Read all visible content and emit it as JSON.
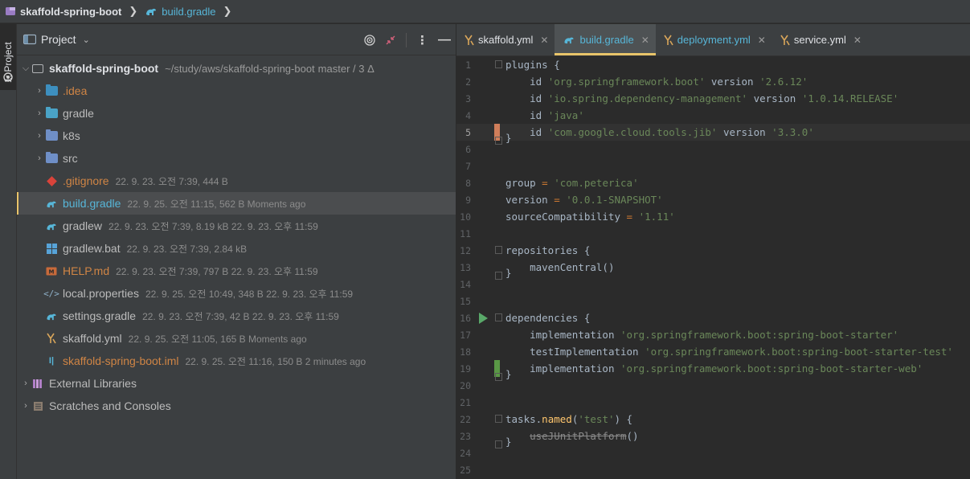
{
  "navbar": {
    "project": "skaffold-spring-boot",
    "file": "build.gradle"
  },
  "stripe": {
    "label": "1: Project"
  },
  "panel": {
    "title": "Project",
    "root": {
      "name": "skaffold-spring-boot",
      "path": "~/study/aws/skaffold-spring-boot",
      "branch": "master / 3 Δ"
    },
    "items": [
      {
        "name": ".idea",
        "meta": ""
      },
      {
        "name": "gradle",
        "meta": ""
      },
      {
        "name": "k8s",
        "meta": ""
      },
      {
        "name": "src",
        "meta": ""
      },
      {
        "name": ".gitignore",
        "meta": "22. 9. 23. 오전 7:39, 444 B"
      },
      {
        "name": "build.gradle",
        "meta": "22. 9. 25. 오전 11:15, 562 B Moments ago"
      },
      {
        "name": "gradlew",
        "meta": "22. 9. 23. 오전 7:39, 8.19 kB 22. 9. 23. 오후 11:59"
      },
      {
        "name": "gradlew.bat",
        "meta": "22. 9. 23. 오전 7:39, 2.84 kB"
      },
      {
        "name": "HELP.md",
        "meta": "22. 9. 23. 오전 7:39, 797 B 22. 9. 23. 오후 11:59"
      },
      {
        "name": "local.properties",
        "meta": "22. 9. 25. 오전 10:49, 348 B 22. 9. 23. 오후 11:59"
      },
      {
        "name": "settings.gradle",
        "meta": "22. 9. 23. 오전 7:39, 42 B 22. 9. 23. 오후 11:59"
      },
      {
        "name": "skaffold.yml",
        "meta": "22. 9. 25. 오전 11:05, 165 B Moments ago"
      },
      {
        "name": "skaffold-spring-boot.iml",
        "meta": "22. 9. 25. 오전 11:16, 150 B 2 minutes ago"
      }
    ],
    "external": "External Libraries",
    "scratches": "Scratches and Consoles"
  },
  "tabs": [
    {
      "label": "skaffold.yml"
    },
    {
      "label": "build.gradle"
    },
    {
      "label": "deployment.yml"
    },
    {
      "label": "service.yml"
    }
  ],
  "code": {
    "line_numbers": [
      "1",
      "2",
      "3",
      "4",
      "5",
      "6",
      "7",
      "8",
      "9",
      "10",
      "11",
      "12",
      "13",
      "14",
      "15",
      "16",
      "17",
      "18",
      "19",
      "20",
      "21",
      "22",
      "23",
      "24",
      "25"
    ],
    "l1": "plugins",
    "l2_id": "id",
    "l2_str": "'org.springframework.boot'",
    "l2_v": "version",
    "l2_ver": "'2.6.12'",
    "l3_str": "'io.spring.dependency-management'",
    "l3_ver": "'1.0.14.RELEASE'",
    "l4_str": "'java'",
    "l5_str": "'com.google.cloud.tools.jib'",
    "l5_ver": "'3.3.0'",
    "l8_k": "group",
    "l8_v": "'com.peterica'",
    "l9_k": "version",
    "l9_v": "'0.0.1-SNAPSHOT'",
    "l10_k": "sourceCompatibility",
    "l10_v": "'1.11'",
    "l12": "repositories",
    "l13": "mavenCentral",
    "l16": "dependencies",
    "l17_k": "implementation",
    "l17_v": "'org.springframework.boot:spring-boot-starter'",
    "l18_k": "testImplementation",
    "l18_v": "'org.springframework.boot:spring-boot-starter-test'",
    "l19_k": "implementation",
    "l19_v": "'org.springframework.boot:spring-boot-starter-web'",
    "l22_a": "tasks",
    "l22_b": "named",
    "l22_s": "'test'",
    "l23": "useJUnitPlatform"
  },
  "colors": {
    "accent": "#e8c46a",
    "keyword": "#cc7832",
    "string": "#6a8759",
    "function": "#ffc66d",
    "modified_marker": "#d07e5a",
    "added_marker": "#5a9846"
  }
}
